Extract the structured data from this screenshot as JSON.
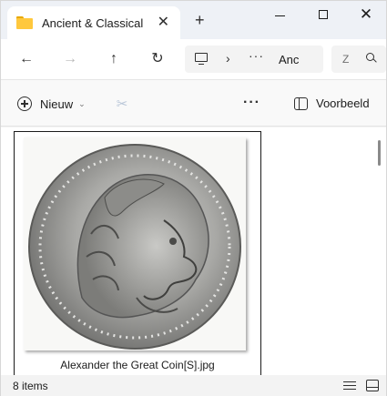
{
  "window": {
    "tab_title": "Ancient & Classical",
    "tab_close_glyph": "✕",
    "new_tab_glyph": "+",
    "minimize_label": "Minimize",
    "maximize_label": "Maximize",
    "close_glyph": "✕"
  },
  "navigation": {
    "back_glyph": "←",
    "forward_glyph": "→",
    "up_glyph": "↑",
    "refresh_glyph": "↻",
    "address_separator": "›",
    "address_more": "···",
    "address_crumb": "Anc",
    "search_placeholder": "Z"
  },
  "commandbar": {
    "new_label": "Nieuw",
    "new_chevron": "⌄",
    "cut_glyph": "✂",
    "more_glyph": "···",
    "preview_label": "Voorbeeld"
  },
  "content": {
    "files": [
      {
        "name": "Alexander the Great Coin[S].jpg",
        "thumbnail": "silver-coin-alexander-head"
      }
    ]
  },
  "status": {
    "item_count": "8 items"
  },
  "colors": {
    "accent_folder": "#ffc83d",
    "window_bg": "#f3f3f3",
    "disabled_icon": "#bcc7d6"
  },
  "icons": {
    "folder": "folder-icon",
    "new": "plus-circle-icon",
    "cut": "scissors-icon",
    "copy": "copy-icon",
    "paste": "paste-icon",
    "preview": "preview-pane-icon",
    "details_view": "details-view-icon",
    "tiles_view": "tiles-view-icon"
  }
}
